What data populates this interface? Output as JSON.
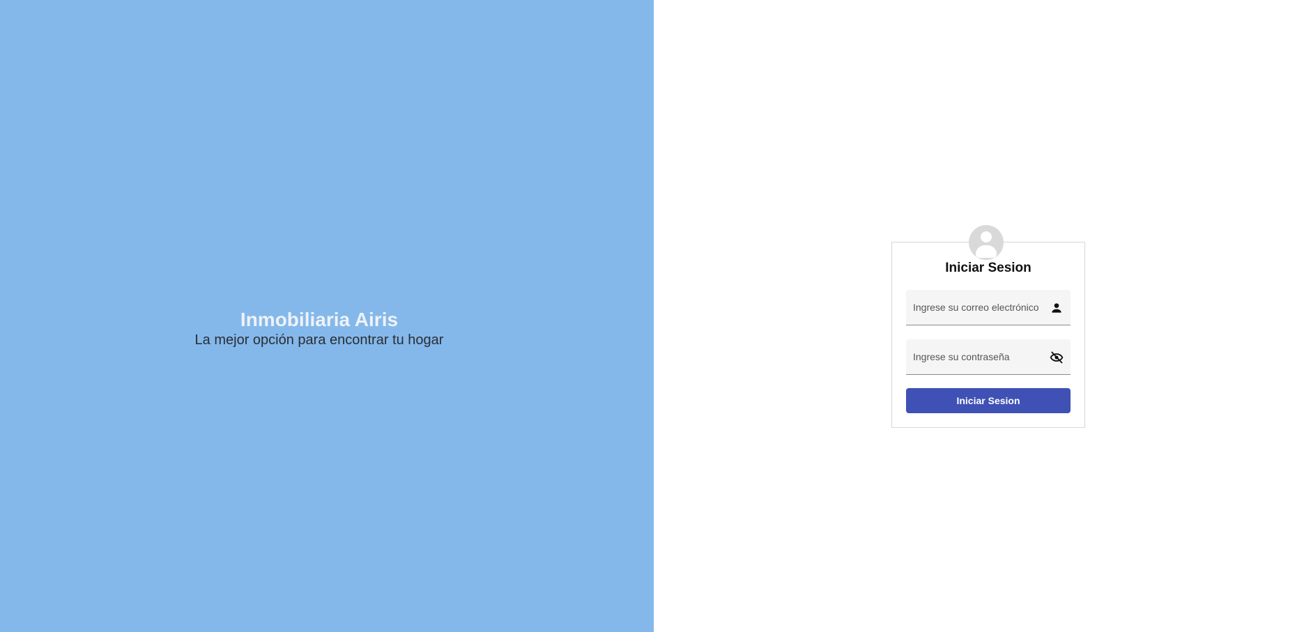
{
  "hero": {
    "title": "Inmobiliaria Airis",
    "subtitle": "La mejor opción para encontrar tu hogar",
    "background_color": "#84b8eb"
  },
  "login": {
    "title": "Iniciar Sesion",
    "email": {
      "placeholder": "Ingrese su correo electrónico",
      "value": "",
      "icon": "person-icon"
    },
    "password": {
      "placeholder": "Ingrese su contraseña",
      "value": "",
      "icon": "visibility-off-icon"
    },
    "submit_label": "Iniciar Sesion",
    "avatar_icon": "account-circle-icon",
    "accent_color": "#3f51b5"
  }
}
